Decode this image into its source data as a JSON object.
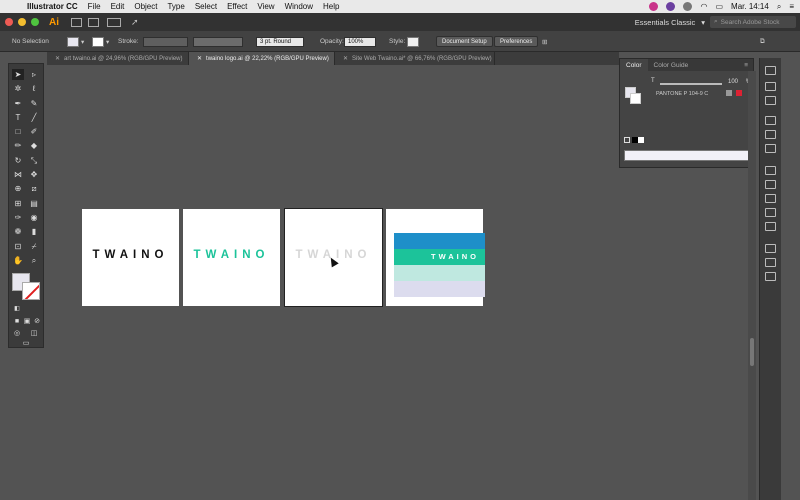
{
  "menubar": {
    "app_name": "Illustrator CC",
    "items": [
      "File",
      "Edit",
      "Object",
      "Type",
      "Select",
      "Effect",
      "View",
      "Window",
      "Help"
    ],
    "clock": "Mar. 14:14"
  },
  "appbar": {
    "logo": "Ai",
    "workspace": "Essentials Classic",
    "search_placeholder": "Search Adobe Stock"
  },
  "controlbar": {
    "selection": "No Selection",
    "stroke_label": "Stroke:",
    "stroke_profile": "3 pt. Round",
    "opacity_label": "Opacity:",
    "opacity_value": "100%",
    "style_label": "Style:",
    "document_setup": "Document Setup",
    "preferences": "Preferences"
  },
  "tabs": [
    {
      "label": "art twaino.ai @ 24,96% (RGB/GPU Preview)",
      "active": false
    },
    {
      "label": "twaino logo.ai @ 22,22% (RGB/GPU Preview)",
      "active": true
    },
    {
      "label": "Site Web Twaino.ai* @ 66,76% (RGB/GPU Preview)",
      "active": false
    }
  ],
  "artboards": [
    {
      "text": "TWAINO",
      "color": "#111111"
    },
    {
      "text": "TWAINO",
      "color": "#1cc39a"
    },
    {
      "text": "TWAINO",
      "color": "#d6d6d6"
    },
    {
      "text": "TWAINO",
      "color": "#ffffff"
    }
  ],
  "palette_stripes": [
    "#1e8fc9",
    "#1cc39a",
    "#bfe8e0",
    "#dcdcee"
  ],
  "colorpanel": {
    "tab_color": "Color",
    "tab_guide": "Color Guide",
    "tint_label": "T",
    "tint_value": "100",
    "tint_unit": "%",
    "swatch_name": "PANTONE P 104-9 C"
  },
  "colors": {
    "fill": "#e7e6ef",
    "brand_teal": "#1cc39a",
    "brand_blue": "#1e8fc9",
    "accent_orange": "#ff9a00"
  }
}
